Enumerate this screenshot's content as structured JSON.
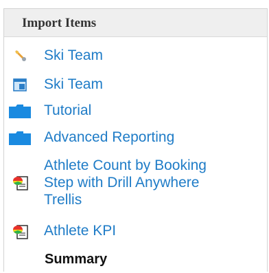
{
  "panel": {
    "title": "Import Items"
  },
  "items": [
    {
      "label": "Ski Team",
      "icon": "wand-icon"
    },
    {
      "label": "Ski Team",
      "icon": "dashboard-icon"
    },
    {
      "label": "Tutorial",
      "icon": "folder-icon"
    },
    {
      "label": "Advanced Reporting",
      "icon": "folder-icon"
    },
    {
      "label_lines": [
        "Athlete Count by Booking",
        "Step with Drill Anywhere",
        "Trellis"
      ],
      "icon": "report-icon"
    },
    {
      "label": "Athlete KPI",
      "icon": "report-icon"
    }
  ],
  "summary": {
    "label": "Summary"
  },
  "colors": {
    "link": "#1f7cc7",
    "folder": "#1a8ae0",
    "header_bg": "#efefef"
  }
}
